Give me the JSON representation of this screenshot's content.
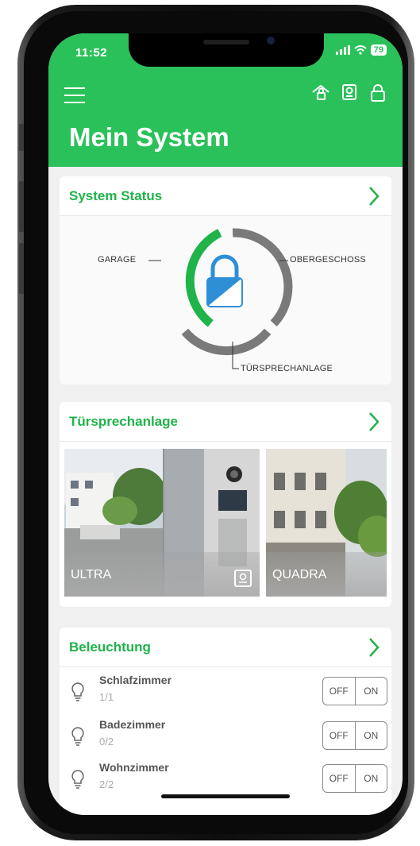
{
  "status_bar": {
    "time": "11:52",
    "battery": "79"
  },
  "header": {
    "title": "Mein System"
  },
  "system_status": {
    "title": "System Status",
    "segments": [
      "GARAGE",
      "OBERGESCHOSS",
      "TÜRSPRECHANLAGE"
    ],
    "colors": {
      "active": "#1fb34a",
      "inactive": "#7a7a7a",
      "lock": "#2e8fd6"
    }
  },
  "intercom": {
    "title": "Türsprechanlage",
    "tiles": [
      {
        "label": "ULTRA"
      },
      {
        "label": "QUADRA"
      }
    ]
  },
  "lighting": {
    "title": "Beleuchtung",
    "rooms": [
      {
        "name": "Schlafzimmer",
        "count": "1/1",
        "off": "OFF",
        "on": "ON"
      },
      {
        "name": "Badezimmer",
        "count": "0/2",
        "off": "OFF",
        "on": "ON"
      },
      {
        "name": "Wohnzimmer",
        "count": "2/2",
        "off": "OFF",
        "on": "ON"
      }
    ]
  },
  "theme": {
    "brand_green": "#2bc15a"
  }
}
